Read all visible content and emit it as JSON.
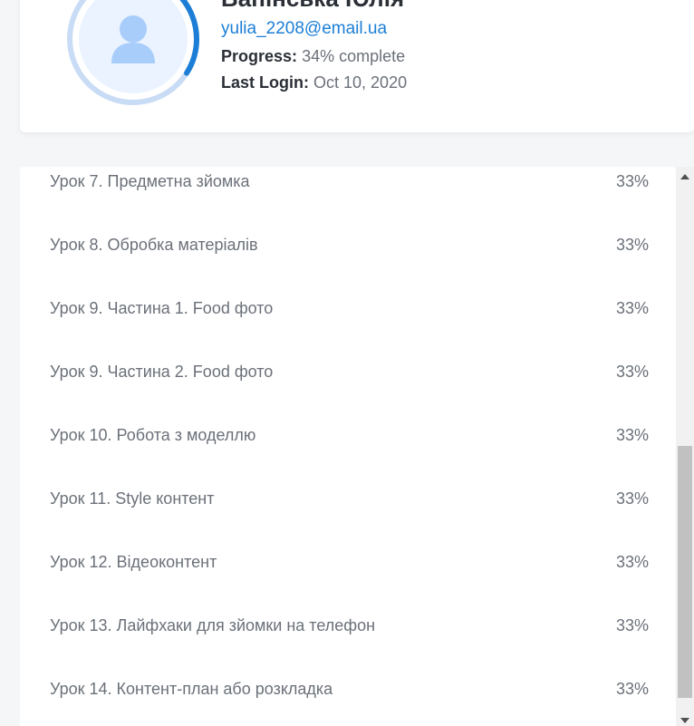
{
  "profile": {
    "name": "Вапінська Юлія",
    "email": "yulia_2208@email.ua",
    "progress_label": "Progress:",
    "progress_value": "34% complete",
    "progress_fraction": 0.34,
    "last_login_label": "Last Login:",
    "last_login_value": "Oct 10, 2020"
  },
  "colors": {
    "accent": "#1c7ed6",
    "ring_bg": "#c9dcf5",
    "avatar_bg": "#eaf3ff",
    "avatar_icon": "#a9cdfb"
  },
  "lessons": [
    {
      "title": "Урок 7. Предметна зйомка",
      "percent": "33%"
    },
    {
      "title": "Урок 8. Обробка матеріалів",
      "percent": "33%"
    },
    {
      "title": "Урок 9. Частина 1. Food фото",
      "percent": "33%"
    },
    {
      "title": "Урок 9. Частина 2. Food фото",
      "percent": "33%"
    },
    {
      "title": "Урок 10. Робота з моделлю",
      "percent": "33%"
    },
    {
      "title": "Урок 11. Style контент",
      "percent": "33%"
    },
    {
      "title": "Урок 12. Відеоконтент",
      "percent": "33%"
    },
    {
      "title": "Урок 13. Лайфхаки для зйомки на телефон",
      "percent": "33%"
    },
    {
      "title": "Урок 14. Контент-план або розкладка",
      "percent": "33%"
    }
  ]
}
